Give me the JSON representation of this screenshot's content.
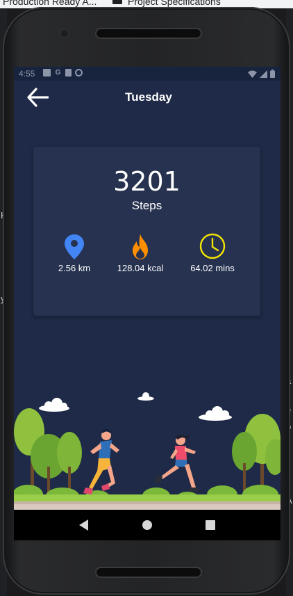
{
  "desktop": {
    "tab1": "Production Ready A...",
    "tab2": "Project Specifications",
    "right_marks": [
      "f",
      "a",
      "e",
      "p",
      "s",
      "A"
    ],
    "left_marks": [
      "H",
      "y"
    ]
  },
  "status_bar": {
    "time": "4:55",
    "left_icons": [
      "image-icon",
      "google-icon",
      "sd-card-icon",
      "sync-icon"
    ],
    "right_icons": [
      "wifi-icon",
      "signal-icon",
      "battery-icon"
    ]
  },
  "app_bar": {
    "back_icon": "arrow-left-icon",
    "title": "Tuesday"
  },
  "summary": {
    "steps_value": "3201",
    "steps_label": "Steps",
    "distance": {
      "icon": "location-pin-icon",
      "value": "2.56 km",
      "color": "#4285f4"
    },
    "calories": {
      "icon": "flame-icon",
      "value": "128.04 kcal",
      "color": "#ff8f00"
    },
    "duration": {
      "icon": "clock-icon",
      "value": "64.02 mins",
      "color": "#f3e500"
    }
  },
  "illustration": {
    "name": "running-couple-park-illustration"
  },
  "nav_bar": {
    "back_icon": "triangle-back-icon",
    "home_icon": "circle-home-icon",
    "recents_icon": "square-recents-icon"
  },
  "colors": {
    "screen_bg": "#1e2a47",
    "card_bg": "#26324f",
    "text": "#ffffff"
  }
}
